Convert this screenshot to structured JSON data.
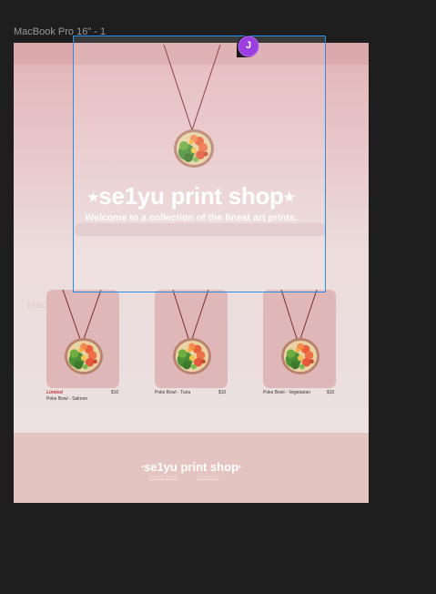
{
  "canvas": {
    "frame_label": "MacBook Pro 16\" - 1",
    "ghost_frame_label": "MacBook Pro 16\" - 1"
  },
  "hero": {
    "star_left": "★",
    "title": "se1yu print shop",
    "star_right": "★",
    "subtitle": "Welcome to a collection of the finest art prints."
  },
  "products": [
    {
      "badge": "Limited",
      "name": "Poke Bowl - Salmon",
      "price": "$10"
    },
    {
      "badge": "",
      "name": "Poke Bowl - Tuna",
      "price": "$10"
    },
    {
      "badge": "",
      "name": "Poke Bowl - Vegetarian",
      "price": "$10"
    }
  ],
  "footer": {
    "logo": "se1yu print shop",
    "logo_dot_left": "•",
    "logo_dot_right": "•",
    "links": [
      "Privacy Terms",
      "Contact Us"
    ]
  },
  "collaborator": {
    "initial": "J",
    "color": "#9b3ee0"
  },
  "colors": {
    "selection": "#2d8ce6",
    "card_bg": "#dfb7b9",
    "footer_bg": "#e4c4c0",
    "limited": "#c0393f"
  }
}
